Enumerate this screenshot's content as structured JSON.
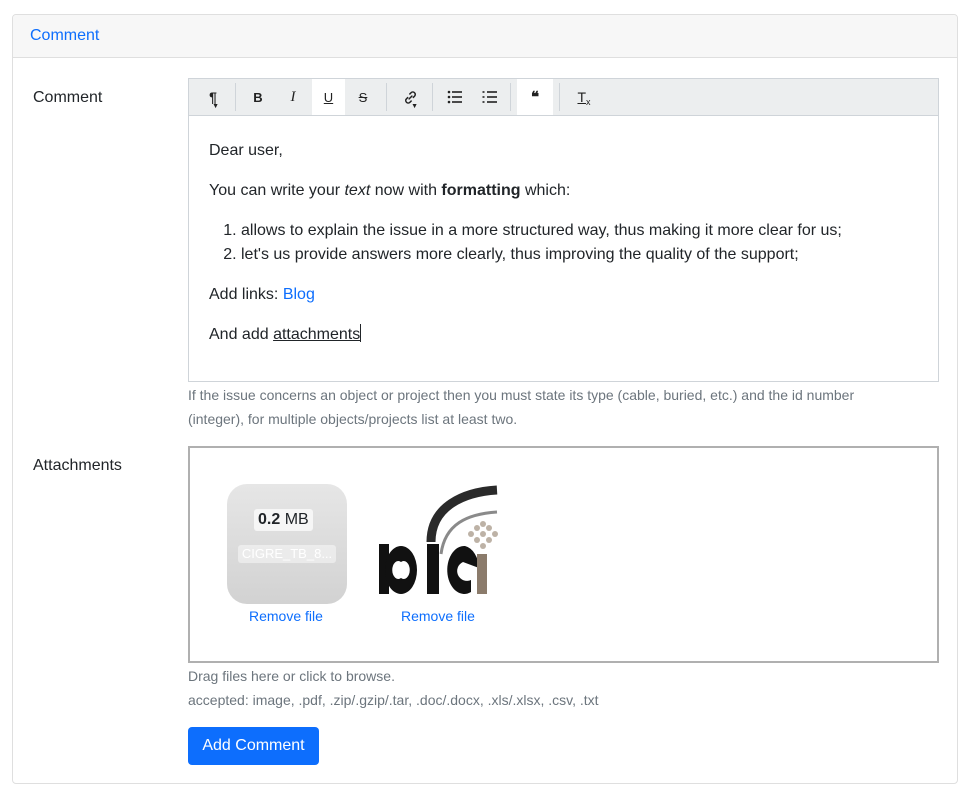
{
  "card": {
    "title": "Comment"
  },
  "comment": {
    "label": "Comment",
    "toolbar": {
      "paragraph": "¶",
      "bold": "B",
      "italic": "I",
      "underline": "U",
      "strike": "S",
      "link": "🔗",
      "bullet_list": "☰",
      "ordered_list": "≡",
      "blockquote": "❝",
      "clear_format": "T"
    },
    "content": {
      "greeting": "Dear user,",
      "line2_a": "You can write your ",
      "line2_italic": "text",
      "line2_b": " now with ",
      "line2_bold": "formatting",
      "line2_c": " which:",
      "list": [
        "allows to explain the issue in a more structured way, thus making it more clear for us;",
        "let's us provide answers more clearly, thus improving the quality of the support;"
      ],
      "links_label": "Add links: ",
      "links_link": "Blog",
      "attach_label": "And add ",
      "attach_word": "attachments"
    },
    "help_line1": "If the issue concerns an object or project then you must state its type (cable, buried, etc.) and the id number",
    "help_line2": "(integer), for multiple objects/projects list at least two."
  },
  "attachments": {
    "label": "Attachments",
    "files": [
      {
        "size_value": "0.2",
        "size_unit": " MB",
        "name": "CIGRE_TB_8...",
        "remove_label": "Remove file"
      },
      {
        "remove_label": "Remove file"
      }
    ],
    "help_line1": "Drag files here or click to browse.",
    "help_line2": "accepted: image, .pdf, .zip/.gzip/.tar, .doc/.docx, .xls/.xlsx, .csv, .txt"
  },
  "submit_label": "Add Comment",
  "colors": {
    "primary": "#0d6efd",
    "muted": "#6c757d",
    "toolbar_bg": "#eceeef"
  }
}
